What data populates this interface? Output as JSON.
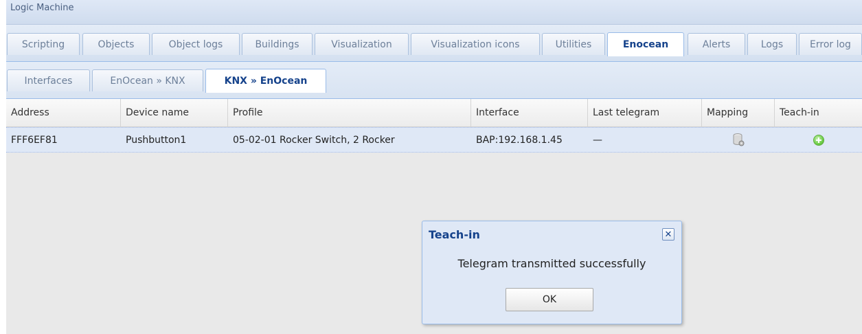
{
  "app": {
    "title": "Logic Machine"
  },
  "main_tabs": [
    {
      "label": "Scripting"
    },
    {
      "label": "Objects"
    },
    {
      "label": "Object logs"
    },
    {
      "label": "Buildings"
    },
    {
      "label": "Visualization"
    },
    {
      "label": "Visualization icons"
    },
    {
      "label": "Utilities"
    },
    {
      "label": "Enocean"
    },
    {
      "label": "Alerts"
    },
    {
      "label": "Logs"
    },
    {
      "label": "Error log"
    }
  ],
  "active_main_tab": "Enocean",
  "sub_tabs": [
    {
      "label": "Interfaces"
    },
    {
      "label": "EnOcean » KNX"
    },
    {
      "label": "KNX » EnOcean"
    }
  ],
  "active_sub_tab": "KNX » EnOcean",
  "grid": {
    "columns": [
      "Address",
      "Device name",
      "Profile",
      "Interface",
      "Last telegram",
      "Mapping",
      "Teach-in"
    ],
    "rows": [
      {
        "address": "FFF6EF81",
        "device_name": "Pushbutton1",
        "profile": "05-02-01 Rocker Switch, 2 Rocker",
        "interface": "BAP:192.168.1.45",
        "last_telegram": "—",
        "mapping_icon": "database-gear-icon",
        "teach_in_icon": "add-circle-icon"
      }
    ]
  },
  "dialog": {
    "title": "Teach-in",
    "close_icon": "close-icon",
    "message": "Telegram transmitted successfully",
    "ok_label": "OK"
  },
  "colors": {
    "accent": "#15428b",
    "header_bg": "#dfe8f6",
    "tab_border": "#99bbe8",
    "selected_row": "#dfe8f6",
    "teach_green": "#6fcf4a"
  }
}
